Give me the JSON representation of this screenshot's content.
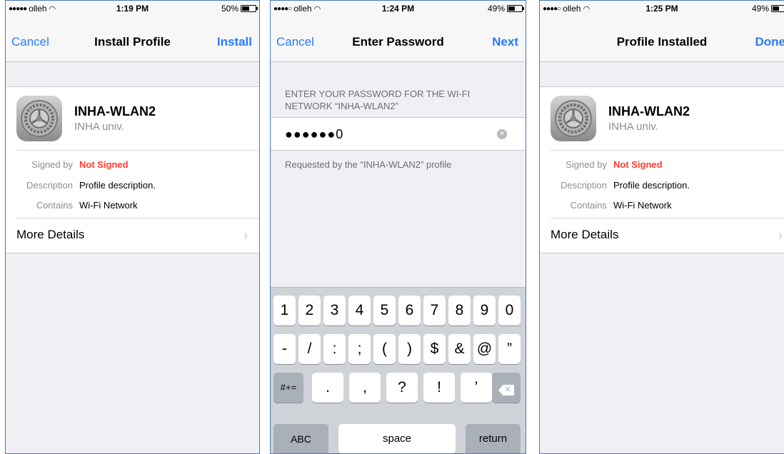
{
  "screens": [
    {
      "status": {
        "carrier": "olleh",
        "signal_dots": "●●●●●",
        "time": "1:19 PM",
        "battery": "50%",
        "battery_level": 0.5
      },
      "nav": {
        "left": "Cancel",
        "title": "Install Profile",
        "right": "Install"
      },
      "profile": {
        "name": "INHA-WLAN2",
        "org": "INHA univ.",
        "rows": [
          {
            "key": "Signed by",
            "value": "Not Signed"
          },
          {
            "key": "Description",
            "value": "Profile description."
          },
          {
            "key": "Contains",
            "value": "Wi-Fi Network"
          }
        ],
        "more_details": "More Details"
      }
    },
    {
      "status": {
        "carrier": "olleh",
        "signal_dots": "●●●●○",
        "time": "1:24 PM",
        "battery": "49%",
        "battery_level": 0.49
      },
      "nav": {
        "left": "Cancel",
        "title": "Enter Password",
        "right": "Next"
      },
      "password": {
        "header": "ENTER YOUR PASSWORD FOR THE WI-FI NETWORK “INHA-WLAN2”",
        "value": "●●●●●●0",
        "footer": "Requested by the “INHA-WLAN2” profile"
      },
      "keyboard": {
        "row1": [
          "1",
          "2",
          "3",
          "4",
          "5",
          "6",
          "7",
          "8",
          "9",
          "0"
        ],
        "row2": [
          "-",
          "/",
          ":",
          ";",
          "(",
          ")",
          "$",
          "&",
          "@",
          "”"
        ],
        "row3_left": "#+=",
        "row3": [
          ".",
          ",",
          "?",
          "!",
          "’"
        ],
        "abc": "ABC",
        "space": "space",
        "return": "return"
      }
    },
    {
      "status": {
        "carrier": "olleh",
        "signal_dots": "●●●●○",
        "time": "1:25 PM",
        "battery": "49%",
        "battery_level": 0.49
      },
      "nav": {
        "left": "",
        "title": "Profile Installed",
        "right": "Done"
      },
      "profile": {
        "name": "INHA-WLAN2",
        "org": "INHA univ.",
        "rows": [
          {
            "key": "Signed by",
            "value": "Not Signed"
          },
          {
            "key": "Description",
            "value": "Profile description."
          },
          {
            "key": "Contains",
            "value": "Wi-Fi Network"
          }
        ],
        "more_details": "More Details"
      }
    }
  ],
  "colors": {
    "accent": "#2a7cf6",
    "warning": "#ff3b30",
    "background": "#efeff4"
  },
  "icons": [
    "settings-gear-icon",
    "wifi-icon",
    "battery-icon",
    "chevron-right-icon",
    "clear-icon",
    "delete-icon"
  ]
}
